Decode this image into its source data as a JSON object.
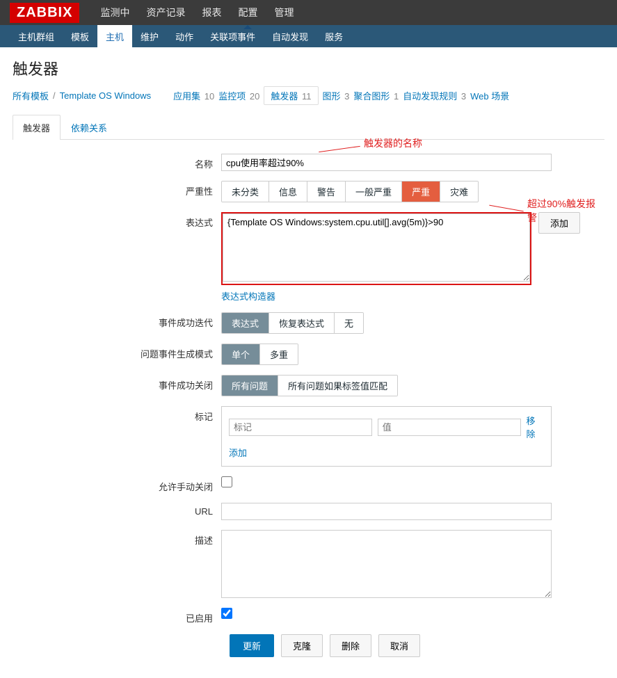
{
  "logo": "ZABBIX",
  "topmenu": [
    {
      "label": "监测中"
    },
    {
      "label": "资产记录"
    },
    {
      "label": "报表"
    },
    {
      "label": "配置",
      "active": true
    },
    {
      "label": "管理"
    }
  ],
  "submenu": [
    {
      "label": "主机群组"
    },
    {
      "label": "模板"
    },
    {
      "label": "主机",
      "active": true
    },
    {
      "label": "维护"
    },
    {
      "label": "动作"
    },
    {
      "label": "关联项事件"
    },
    {
      "label": "自动发现"
    },
    {
      "label": "服务"
    }
  ],
  "page_title": "触发器",
  "breadcrumb": {
    "all_templates": "所有模板",
    "template_name": "Template OS Windows",
    "items": [
      {
        "label": "应用集",
        "count": "10"
      },
      {
        "label": "监控项",
        "count": "20"
      },
      {
        "label": "触发器",
        "count": "11",
        "current": true
      },
      {
        "label": "图形",
        "count": "3"
      },
      {
        "label": "聚合图形",
        "count": "1"
      },
      {
        "label": "自动发现规则",
        "count": "3"
      },
      {
        "label": "Web 场景",
        "count": ""
      }
    ]
  },
  "tabs": [
    {
      "label": "触发器",
      "active": true
    },
    {
      "label": "依赖关系"
    }
  ],
  "annotations": {
    "name_hint": "触发器的名称",
    "expr_hint": "超过90%触发报警"
  },
  "form": {
    "name_label": "名称",
    "name_value": "cpu使用率超过90%",
    "severity_label": "严重性",
    "severities": [
      "未分类",
      "信息",
      "警告",
      "一般严重",
      "严重",
      "灾难"
    ],
    "severity_selected_index": 4,
    "expr_label": "表达式",
    "expr_value": "{Template OS Windows:system.cpu.util[].avg(5m)}>90",
    "expr_add_btn": "添加",
    "expr_constructor": "表达式构造器",
    "ok_iter_label": "事件成功迭代",
    "ok_iter_options": [
      "表达式",
      "恢复表达式",
      "无"
    ],
    "ok_iter_selected": 0,
    "problem_mode_label": "问题事件生成模式",
    "problem_mode_options": [
      "单个",
      "多重"
    ],
    "problem_mode_selected": 0,
    "ok_close_label": "事件成功关闭",
    "ok_close_options": [
      "所有问题",
      "所有问题如果标签值匹配"
    ],
    "ok_close_selected": 0,
    "tags_label": "标记",
    "tag_name_placeholder": "标记",
    "tag_value_placeholder": "值",
    "tag_remove": "移除",
    "tag_add": "添加",
    "manual_close_label": "允许手动关闭",
    "manual_close_checked": false,
    "url_label": "URL",
    "url_value": "",
    "desc_label": "描述",
    "desc_value": "",
    "enabled_label": "已启用",
    "enabled_checked": true,
    "buttons": {
      "update": "更新",
      "clone": "克隆",
      "delete": "删除",
      "cancel": "取消"
    }
  }
}
